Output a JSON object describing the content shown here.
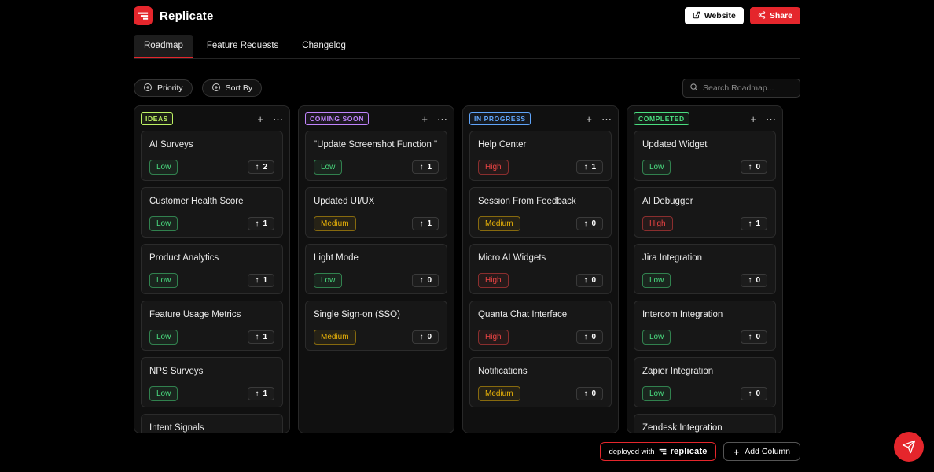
{
  "header": {
    "app_name": "Replicate",
    "website_button": "Website",
    "share_button": "Share"
  },
  "tabs": [
    {
      "label": "Roadmap",
      "active": true
    },
    {
      "label": "Feature Requests",
      "active": false
    },
    {
      "label": "Changelog",
      "active": false
    }
  ],
  "toolbar": {
    "priority_label": "Priority",
    "sort_label": "Sort By",
    "search_placeholder": "Search Roadmap..."
  },
  "priority_colors": {
    "Low": "#4ade80",
    "Medium": "#eab308",
    "High": "#ef4444"
  },
  "board": {
    "columns": [
      {
        "label": "IDEAS",
        "color": "#bef264",
        "cards": [
          {
            "title": "AI Surveys",
            "priority": "Low",
            "votes": 2
          },
          {
            "title": "Customer Health Score",
            "priority": "Low",
            "votes": 1
          },
          {
            "title": "Product Analytics",
            "priority": "Low",
            "votes": 1
          },
          {
            "title": "Feature Usage Metrics",
            "priority": "Low",
            "votes": 1
          },
          {
            "title": "NPS Surveys",
            "priority": "Low",
            "votes": 1
          },
          {
            "title": "Intent Signals"
          }
        ]
      },
      {
        "label": "COMING SOON",
        "color": "#c084fc",
        "cards": [
          {
            "title": "\"Update Screenshot Function \"",
            "priority": "Low",
            "votes": 1
          },
          {
            "title": "Updated UI/UX",
            "priority": "Medium",
            "votes": 1
          },
          {
            "title": "Light Mode",
            "priority": "Low",
            "votes": 0
          },
          {
            "title": "Single Sign-on (SSO)",
            "priority": "Medium",
            "votes": 0
          }
        ]
      },
      {
        "label": "IN PROGRESS",
        "color": "#60a5fa",
        "cards": [
          {
            "title": "Help Center",
            "priority": "High",
            "votes": 1
          },
          {
            "title": "Session From Feedback",
            "priority": "Medium",
            "votes": 0
          },
          {
            "title": "Micro AI Widgets",
            "priority": "High",
            "votes": 0
          },
          {
            "title": "Quanta Chat Interface",
            "priority": "High",
            "votes": 0
          },
          {
            "title": "Notifications",
            "priority": "Medium",
            "votes": 0
          }
        ]
      },
      {
        "label": "COMPLETED",
        "color": "#4ade80",
        "cards": [
          {
            "title": "Updated Widget",
            "priority": "Low",
            "votes": 0
          },
          {
            "title": "AI Debugger",
            "priority": "High",
            "votes": 1
          },
          {
            "title": "Jira Integration",
            "priority": "Low",
            "votes": 0
          },
          {
            "title": "Intercom Integration",
            "priority": "Low",
            "votes": 0
          },
          {
            "title": "Zapier Integration",
            "priority": "Low",
            "votes": 0
          },
          {
            "title": "Zendesk Integration"
          }
        ]
      }
    ],
    "add_card_icon": "+",
    "column_menu_icon": "⋯",
    "upvote_arrow": "↑"
  },
  "footer": {
    "deployed_text": "deployed with",
    "deployed_brand": "replicate",
    "add_column_label": "Add Column"
  },
  "colors": {
    "accent_red": "#e5262c",
    "background": "#000000",
    "column_ideas": "#bef264",
    "column_coming_soon": "#c084fc",
    "column_in_progress": "#60a5fa",
    "column_completed": "#4ade80"
  }
}
